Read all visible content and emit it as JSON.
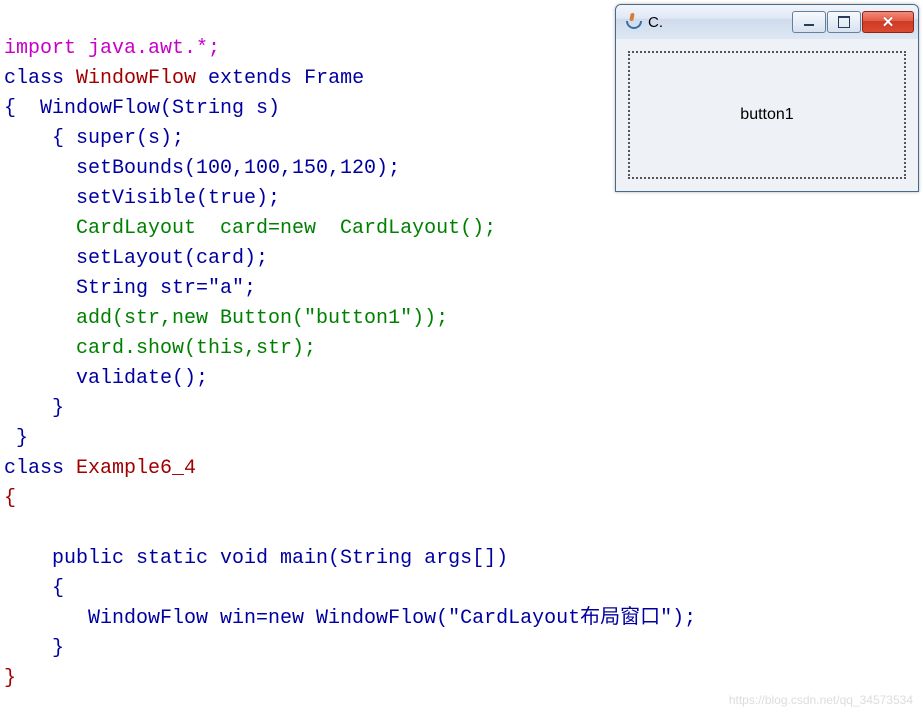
{
  "code": {
    "l1_import": "import",
    "l1_pkg": " java.awt.*;",
    "l2_class": "class",
    "l2_name": " WindowFlow ",
    "l2_extends": "extends",
    "l2_super": " Frame",
    "l3_open": "{  ",
    "l3_ctor": "WindowFlow(String s)",
    "l4": "    { super(s);",
    "l5": "      setBounds(100,100,150,120);",
    "l6": "      setVisible(true);",
    "l7": "      CardLayout  card=new  CardLayout();",
    "l8": "      setLayout(card);",
    "l9": "      String str=\"a\";",
    "l10": "      add(str,new Button(\"button1\"));",
    "l11": "      card.show(this,str);",
    "l12": "      validate();",
    "l13": "    }",
    "l14": " }",
    "l15_class": "class",
    "l15_name": " Example6_4",
    "l16": "{",
    "l17": "    public static void main(String args[])",
    "l18": "    {",
    "l19": "       WindowFlow win=new WindowFlow(\"CardLayout布局窗口\");",
    "l20": "    }",
    "l21": "}"
  },
  "window": {
    "title": "C.",
    "button_label": "button1"
  },
  "watermark": "https://blog.csdn.net/qq_34573534"
}
